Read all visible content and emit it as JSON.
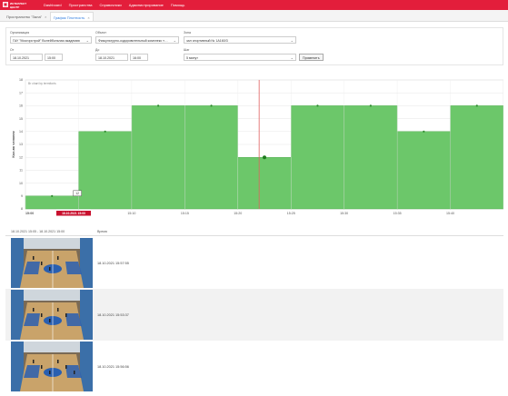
{
  "app": {
    "brand_line1": "ИНТЕЛЛЕКТ",
    "brand_line2": "ЦЕНТР",
    "brand_color": "#e31e3b"
  },
  "nav": [
    "Dashboard",
    "Пространства",
    "Справочники",
    "Администрирование",
    "Помощь"
  ],
  "tabs": [
    {
      "label": "Пространство \"Зала\"",
      "active": false
    },
    {
      "label": "График Плотность",
      "active": true
    }
  ],
  "filters": {
    "org_label": "Организация",
    "org_value": "ГАУ \"Мосгорстрой\" Волейбольная академия",
    "object_label": "Объект",
    "object_value": "Физкультурно-оздоровительный комплекс «…",
    "zone_label": "Зона",
    "zone_value": "зал спортивный № 1А160/3",
    "from_label": "От",
    "from_date": "18.10.2021",
    "from_time": "15:00",
    "to_label": "До",
    "to_date": "18.10.2021",
    "to_time": "16:00",
    "step_label": "Шаг",
    "step_value": "5 минут",
    "apply_label": "Применить"
  },
  "chart_data": {
    "type": "bar",
    "ylabel": "Кол-во человек",
    "legend_note": "Br chart by terrnitoris",
    "yticks": [
      8,
      9,
      10,
      11,
      12,
      13,
      14,
      15,
      16,
      17,
      18
    ],
    "ylim": [
      8,
      18
    ],
    "xticks": [
      "15:00",
      "15:05",
      "15:10",
      "15:15",
      "15:20",
      "15:25",
      "15:30",
      "15:35",
      "15:40"
    ],
    "values": [
      9,
      14,
      16,
      16,
      12,
      16,
      16,
      14,
      16
    ],
    "tooltip_value": "12",
    "highlight_label": "18.10.2021 15:00",
    "bar_color": "#6cc76a",
    "grid": true
  },
  "list": {
    "range_label": "18.10.2021 15:05 - 18.10.2021 15:00",
    "time_header": "Время",
    "rows": [
      {
        "time": "18.10.2021 15:57:55"
      },
      {
        "time": "18.10.2021 15:53:37"
      },
      {
        "time": "18.10.2021 15:56:56"
      }
    ]
  }
}
